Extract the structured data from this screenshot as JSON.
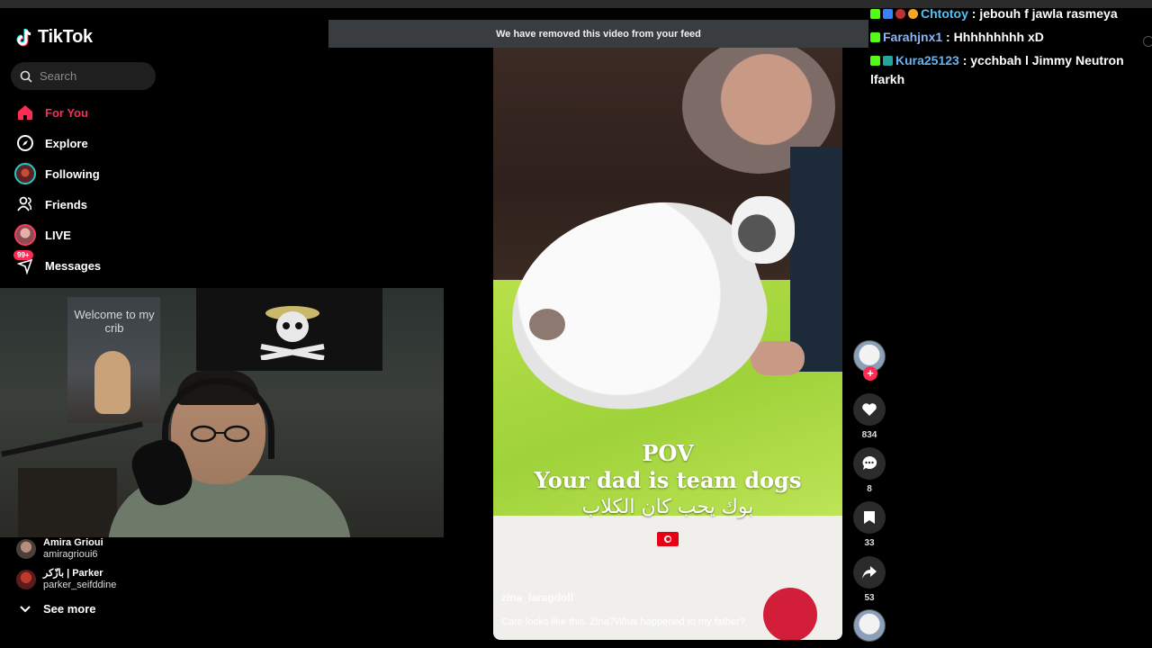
{
  "app": {
    "name": "TikTok"
  },
  "search": {
    "placeholder": "Search"
  },
  "nav": {
    "items": [
      {
        "label": "For You",
        "icon": "home-icon",
        "active": true
      },
      {
        "label": "Explore",
        "icon": "compass-icon"
      },
      {
        "label": "Following",
        "icon": "following-avatar-icon"
      },
      {
        "label": "Friends",
        "icon": "friends-icon"
      },
      {
        "label": "LIVE",
        "icon": "live-avatar-icon"
      },
      {
        "label": "Messages",
        "icon": "messages-icon",
        "badge": "99+"
      }
    ]
  },
  "webcam": {
    "poster_text": "Welcome to my crib"
  },
  "following_accounts": [
    {
      "name": "Amira Grioui",
      "handle": "amiragrioui6"
    },
    {
      "name": "بازّكر | Parker",
      "handle": "parker_seifddine"
    }
  ],
  "see_more": "See more",
  "toast": "We have removed this video from your feed",
  "video": {
    "caption_pov": "POV",
    "caption_line": "Your dad is team dogs",
    "caption_arabic": "بوك يحب كان الكلاب",
    "author": "zina_laragdoll",
    "description": "Care looks like this. Zina?What happened to my father?"
  },
  "actions": {
    "likes": "834",
    "comments": "8",
    "saves": "33",
    "shares": "53"
  },
  "chat": [
    {
      "user": "Chtotoy",
      "message": " : jebouh f jawla rasmeya",
      "user_color": "#4fc3f7"
    },
    {
      "user": "Farahjnx1",
      "message": " : Hhhhhhhhh xD",
      "user_color": "#8ab4f8"
    },
    {
      "user": "Kura25123",
      "message": " : ycchbah l Jimmy Neutron lfarkh",
      "user_color": "#64b5f6"
    }
  ],
  "colors": {
    "accent": "#fe2c55",
    "kick_green": "#53fc18"
  }
}
